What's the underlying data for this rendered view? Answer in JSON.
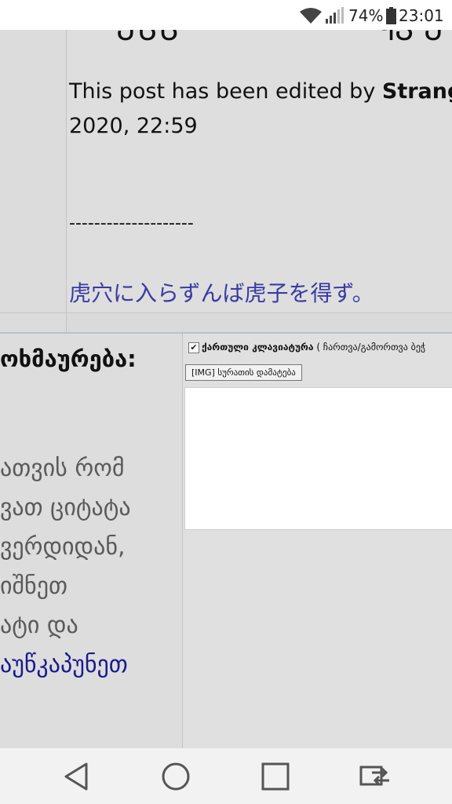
{
  "status_bar": {
    "battery_percent": "74%",
    "time": "23:01",
    "icons": [
      "wifi-icon",
      "signal-icon",
      "battery-icon"
    ]
  },
  "post": {
    "cut_text_left": "ᲔᲡᲡ",
    "cut_text_right": "ႷᲕ Ე",
    "edited_prefix": "This post has been edited by ",
    "edited_user": "Strang",
    "edited_date": "2020, 22:59",
    "signature_separator": "--------------------",
    "signature_quote": "虎穴に入らずんば虎子を得ず。"
  },
  "reply": {
    "title": "ოხმაურება:",
    "instructions": [
      "ათვის რომ",
      "ვათ ციტატა",
      "ვერდიდან,",
      "იშნეთ",
      "ატი და"
    ],
    "instructions_link": "აუწკაპუნეთ",
    "keyboard_checked": true,
    "keyboard_label_bold": "ქართული კლავიატურა",
    "keyboard_label_rest": " ( ჩართვა/გამორთვა ბეჭ",
    "img_button": "[IMG] სურათის დამატება",
    "textarea_value": ""
  },
  "navbar": {
    "buttons": [
      "back-icon",
      "home-icon",
      "recents-icon",
      "switch-apps-icon"
    ]
  }
}
